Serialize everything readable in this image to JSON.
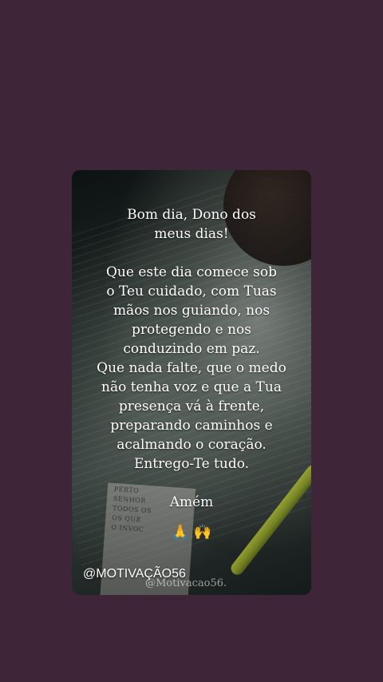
{
  "message": {
    "lines": [
      "Bom dia, Dono dos",
      "meus dias!",
      "",
      "Que este dia comece sob",
      "o Teu cuidado, com Tuas",
      "mãos nos guiando, nos",
      "protegendo e nos",
      "conduzindo em paz.",
      "Que nada falte, que o medo",
      "não tenha voz e que a Tua",
      "presença vá à frente,",
      "preparando caminhos e",
      "acalmando o coração.",
      "Entrego-Te tudo.",
      "",
      "Amém"
    ],
    "emojis": "🙏 🙌"
  },
  "background_book_text": [
    "PERTO",
    "SENHOR",
    "TODOS OS",
    "OS QUE",
    "O INVOC"
  ],
  "handle": "@MOTIVAÇÃO56",
  "watermark": "@Motivacao56."
}
